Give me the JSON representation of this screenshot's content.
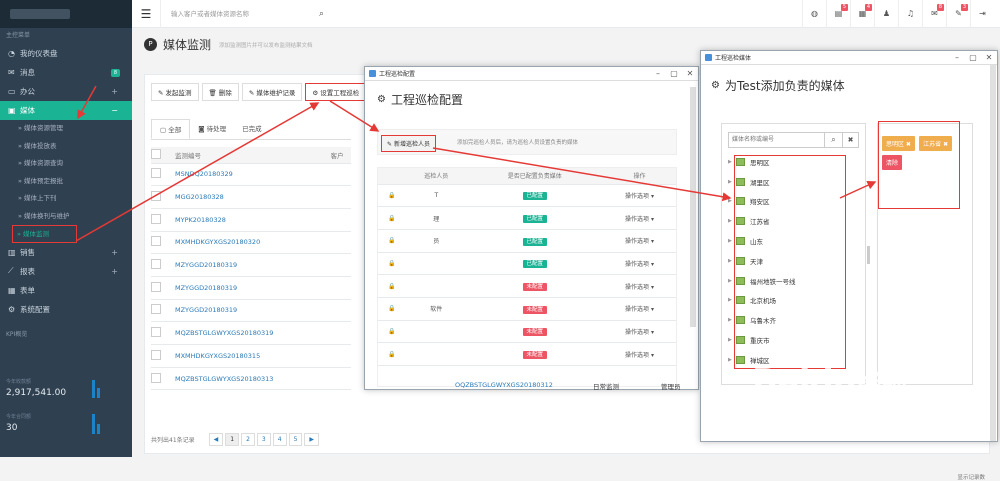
{
  "sidebar": {
    "section_label": "主控菜单",
    "items": [
      {
        "label": "我的仪表盘",
        "icon": "dashboard-icon"
      },
      {
        "label": "消息",
        "badge": "8",
        "icon": "envelope-icon"
      },
      {
        "label": "办公",
        "icon": "monitor-icon"
      },
      {
        "label": "媒体",
        "icon": "image-icon"
      }
    ],
    "sub_items": [
      "媒体资源管理",
      "媒体投放表",
      "媒体资源查询",
      "媒体预定报批",
      "媒体上下刊",
      "媒体换刊与维护",
      "媒体监测"
    ],
    "items_after": [
      {
        "label": "销售",
        "icon": "bar-chart-icon"
      },
      {
        "label": "报表",
        "icon": "line-chart-icon"
      },
      {
        "label": "表单",
        "icon": "table-icon"
      },
      {
        "label": "系统配置",
        "icon": "gear-icon"
      }
    ],
    "kpi_label": "KPI概览",
    "kpi": [
      {
        "label": "今年收款额",
        "value": "2,917,541.00"
      },
      {
        "label": "今年合同额",
        "value": "30"
      }
    ]
  },
  "topbar": {
    "search_placeholder": "输入客户或者媒体资源名称",
    "badges": [
      "5",
      "4",
      "8",
      "3"
    ]
  },
  "page": {
    "title": "媒体监测",
    "subtitle": "添加监测图片并可以发布监测结果文档"
  },
  "toolbar": [
    "发起监测",
    "删除",
    "媒体维护记录",
    "设置工程巡检"
  ],
  "tabs": [
    "全部",
    "待处理",
    "已完成"
  ],
  "table": {
    "headers": [
      "监测编号",
      "客户"
    ],
    "rows": [
      "MSNDQ20180329",
      "MGG20180328",
      "MYPK20180328",
      "MXMHDKGYXGS20180320",
      "MZYGGD20180319",
      "MZYGGD20180319",
      "MZYGGD20180319",
      "MQZBSTGLGWYXGS20180319",
      "MXMHDKGYXGS20180315",
      "MQZBSTGLGWYXGS20180313"
    ]
  },
  "pager": {
    "total": "共列出41条记录",
    "pages": [
      "1",
      "2",
      "3",
      "4",
      "5"
    ],
    "show": "显示记录数"
  },
  "dialog1": {
    "window_title": "工程巡检配置",
    "title": "工程巡检配置",
    "add_button": "新增巡检人员",
    "hint": "添加完巡检人员后，请为巡检人员设置负责的媒体",
    "headers": [
      "巡检人员",
      "是否已配置负责媒体",
      "操作"
    ],
    "rows": [
      {
        "name": "T",
        "status": "已配置",
        "ok": true
      },
      {
        "name": "理",
        "status": "已配置",
        "ok": true
      },
      {
        "name": "员",
        "status": "已配置",
        "ok": true
      },
      {
        "name": "",
        "status": "已配置",
        "ok": true
      },
      {
        "name": "",
        "status": "未配置",
        "ok": false
      },
      {
        "name": "软件",
        "status": "未配置",
        "ok": false
      },
      {
        "name": "",
        "status": "未配置",
        "ok": false
      },
      {
        "name": "",
        "status": "未配置",
        "ok": false
      }
    ],
    "action_label": "操作选项 ▾",
    "bottom_code": "OQZBSTGLGWYXGS20180312",
    "bottom_type": "日常监测",
    "bottom_user": "管理员"
  },
  "dialog2": {
    "window_title": "工程巡检媒体",
    "title": "为Test添加负责的媒体",
    "search_placeholder": "媒体名称或编号",
    "tree": [
      "思明区",
      "湖里区",
      "翔安区",
      "江苏省",
      "山东",
      "天津",
      "福州地铁一号线",
      "北京机场",
      "乌鲁木齐",
      "重庆市",
      "禅城区"
    ],
    "chips": [
      {
        "label": "思明区 ✖",
        "color": "#f0ad4e"
      },
      {
        "label": "江苏省 ✖",
        "color": "#f0ad4e"
      },
      {
        "label": "清除",
        "color": "#ed5565"
      }
    ]
  },
  "watermark": {
    "brand": "Baidu",
    "brand2": "经验",
    "url": "jingyan.baidu.com"
  }
}
